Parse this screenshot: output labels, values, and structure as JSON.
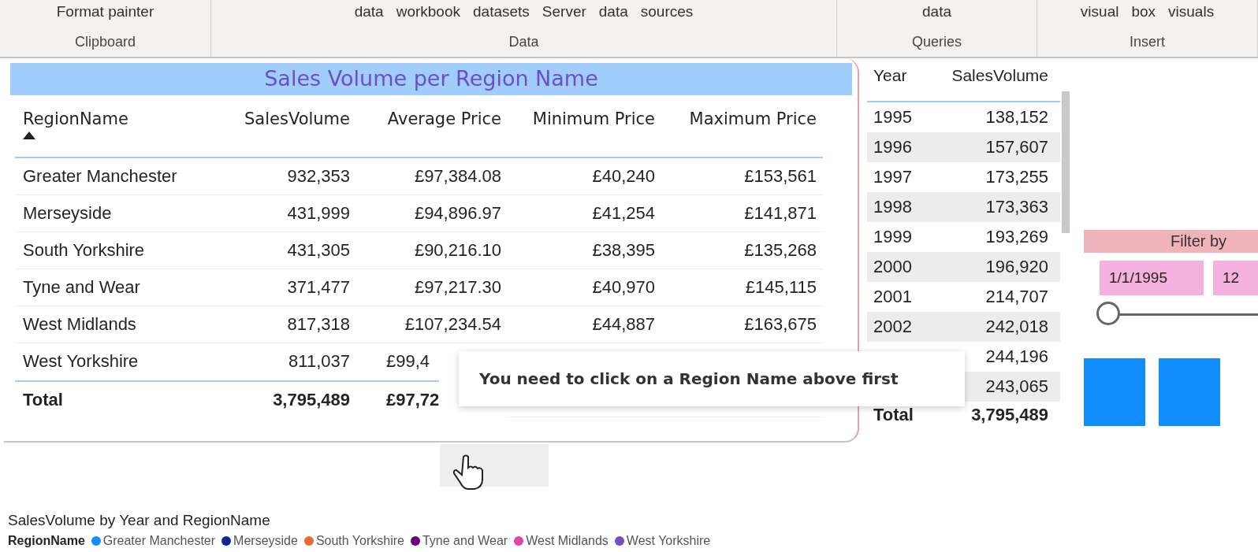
{
  "ribbon": {
    "groups": [
      {
        "label": "Clipboard",
        "items": [
          "Format painter"
        ]
      },
      {
        "label": "Data",
        "items": [
          "data",
          "workbook",
          "datasets",
          "Server",
          "data",
          "sources"
        ]
      },
      {
        "label": "Queries",
        "items": [
          "data"
        ]
      },
      {
        "label": "Insert",
        "items": [
          "visual",
          "box",
          "visuals"
        ]
      }
    ]
  },
  "region_table": {
    "title": "Sales Volume per Region Name",
    "columns": [
      {
        "label": "RegionName",
        "sorted": true
      },
      {
        "label": "SalesVolume",
        "sorted": false
      },
      {
        "label": "Average Price",
        "sorted": false
      },
      {
        "label": "Minimum Price",
        "sorted": false
      },
      {
        "label": "Maximum Price",
        "sorted": false
      }
    ],
    "rows": [
      [
        "Greater Manchester",
        "932,353",
        "£97,384.08",
        "£40,240",
        "£153,561"
      ],
      [
        "Merseyside",
        "431,999",
        "£94,896.97",
        "£41,254",
        "£141,871"
      ],
      [
        "South Yorkshire",
        "431,305",
        "£90,216.10",
        "£38,395",
        "£135,268"
      ],
      [
        "Tyne and Wear",
        "371,477",
        "£97,217.30",
        "£40,970",
        "£145,115"
      ],
      [
        "West Midlands",
        "817,318",
        "£107,234.54",
        "£44,887",
        "£163,675"
      ],
      [
        "West Yorkshire",
        "811,037",
        "£99,4"
      ]
    ],
    "total": [
      "Total",
      "3,795,489",
      "£97,72"
    ]
  },
  "year_table": {
    "columns": [
      "Year",
      "SalesVolume"
    ],
    "rows": [
      {
        "year": "1995",
        "value": "138,152"
      },
      {
        "year": "1996",
        "value": "157,607"
      },
      {
        "year": "1997",
        "value": "173,255"
      },
      {
        "year": "1998",
        "value": "173,363"
      },
      {
        "year": "1999",
        "value": "193,269"
      },
      {
        "year": "2000",
        "value": "196,920"
      },
      {
        "year": "2001",
        "value": "214,707"
      },
      {
        "year": "2002",
        "value": "242,018"
      },
      {
        "value": "244,196"
      },
      {
        "value": "243,065"
      }
    ],
    "total": {
      "label": "Total",
      "value": "3,795,489"
    }
  },
  "slicer": {
    "title": "Filter by",
    "start": "1/1/1995",
    "end": "12",
    "level": 0
  },
  "tooltip": {
    "text": "You need to click on a Region Name above first"
  },
  "chart": {
    "title": "SalesVolume by Year and RegionName",
    "legend_title": "RegionName",
    "legend": [
      {
        "name": "Greater Manchester",
        "color": "#118dff"
      },
      {
        "name": "Merseyside",
        "color": "#12239e"
      },
      {
        "name": "South Yorkshire",
        "color": "#e66c37"
      },
      {
        "name": "Tyne and Wear",
        "color": "#6b007b"
      },
      {
        "name": "West Midlands",
        "color": "#e044a7"
      },
      {
        "name": "West Yorkshire",
        "color": "#744ec2"
      }
    ]
  }
}
